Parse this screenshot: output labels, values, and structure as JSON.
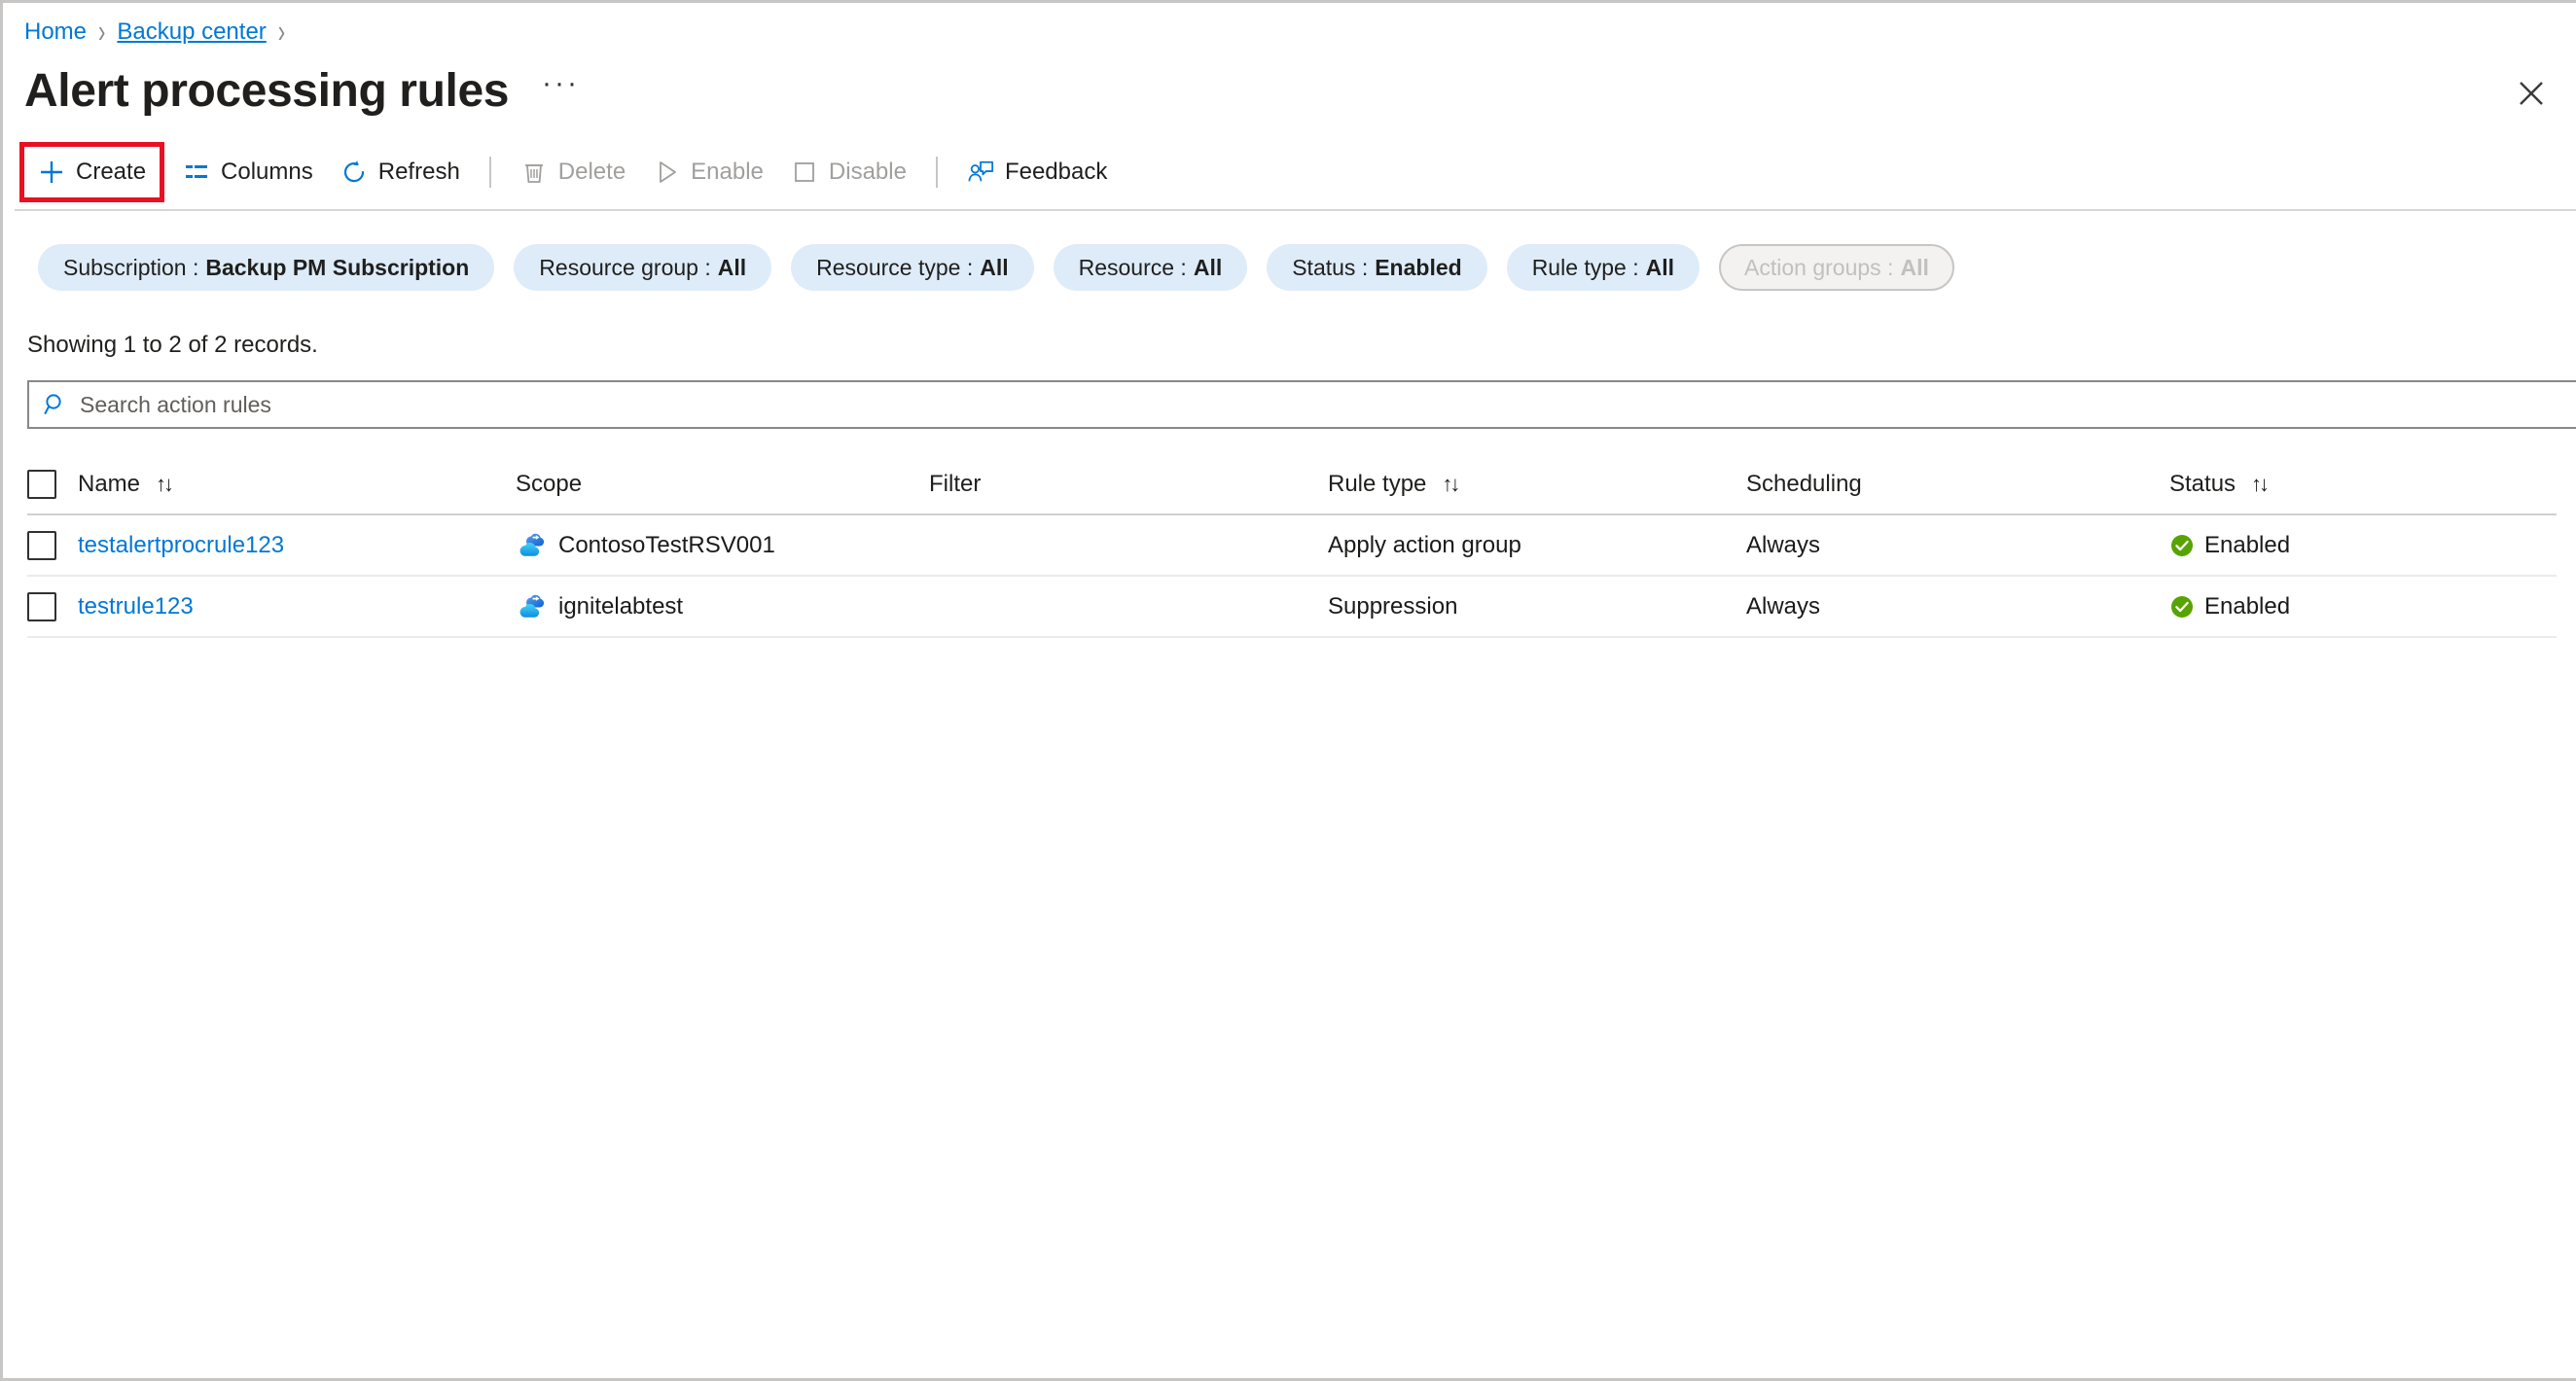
{
  "breadcrumb": {
    "items": [
      {
        "label": "Home",
        "underlined": false
      },
      {
        "label": "Backup center",
        "underlined": true
      }
    ],
    "separator": "›"
  },
  "header": {
    "title": "Alert processing rules",
    "more_label": "···",
    "close_icon": "close-icon"
  },
  "toolbar": {
    "items": [
      {
        "label": "Create",
        "icon": "plus-icon",
        "disabled": false,
        "highlighted": true
      },
      {
        "label": "Columns",
        "icon": "columns-icon",
        "disabled": false,
        "highlighted": false
      },
      {
        "label": "Refresh",
        "icon": "refresh-icon",
        "disabled": false,
        "highlighted": false
      },
      {
        "label": "Delete",
        "icon": "trash-icon",
        "disabled": true,
        "highlighted": false
      },
      {
        "label": "Enable",
        "icon": "play-icon",
        "disabled": true,
        "highlighted": false
      },
      {
        "label": "Disable",
        "icon": "square-icon",
        "disabled": true,
        "highlighted": false
      },
      {
        "label": "Feedback",
        "icon": "feedback-icon",
        "disabled": false,
        "highlighted": false
      }
    ],
    "highlight_color": "#e81123"
  },
  "filters": [
    {
      "name": "Subscription",
      "value": "Backup PM Subscription",
      "disabled": false
    },
    {
      "name": "Resource group",
      "value": "All",
      "disabled": false
    },
    {
      "name": "Resource type",
      "value": "All",
      "disabled": false
    },
    {
      "name": "Resource",
      "value": "All",
      "disabled": false
    },
    {
      "name": "Status",
      "value": "Enabled",
      "disabled": false
    },
    {
      "name": "Rule type",
      "value": "All",
      "disabled": false
    },
    {
      "name": "Action groups",
      "value": "All",
      "disabled": true
    }
  ],
  "records_text": "Showing 1 to 2 of 2 records.",
  "search": {
    "placeholder": "Search action rules",
    "value": "",
    "icon": "search-icon"
  },
  "table": {
    "columns": [
      {
        "label": "Name",
        "sortable": true
      },
      {
        "label": "Scope",
        "sortable": false
      },
      {
        "label": "Filter",
        "sortable": false
      },
      {
        "label": "Rule type",
        "sortable": true
      },
      {
        "label": "Scheduling",
        "sortable": false
      },
      {
        "label": "Status",
        "sortable": true
      }
    ],
    "sort_glyph": "↑↓",
    "rows": [
      {
        "checked": false,
        "name": "testalertprocrule123",
        "scope": "ContosoTestRSV001",
        "scope_icon": "recovery-services-vault-icon",
        "filter": "",
        "rule_type": "Apply action group",
        "scheduling": "Always",
        "status": "Enabled",
        "status_icon": "check-circle-icon"
      },
      {
        "checked": false,
        "name": "testrule123",
        "scope": "ignitelabtest",
        "scope_icon": "recovery-services-vault-icon",
        "filter": "",
        "rule_type": "Suppression",
        "scheduling": "Always",
        "status": "Enabled",
        "status_icon": "check-circle-icon"
      }
    ]
  },
  "colors": {
    "link": "#0078d4",
    "pill_bg": "#deecf9",
    "pill_disabled_bg": "#f3f2f1",
    "status_ok": "#57a300",
    "highlight": "#e81123"
  }
}
